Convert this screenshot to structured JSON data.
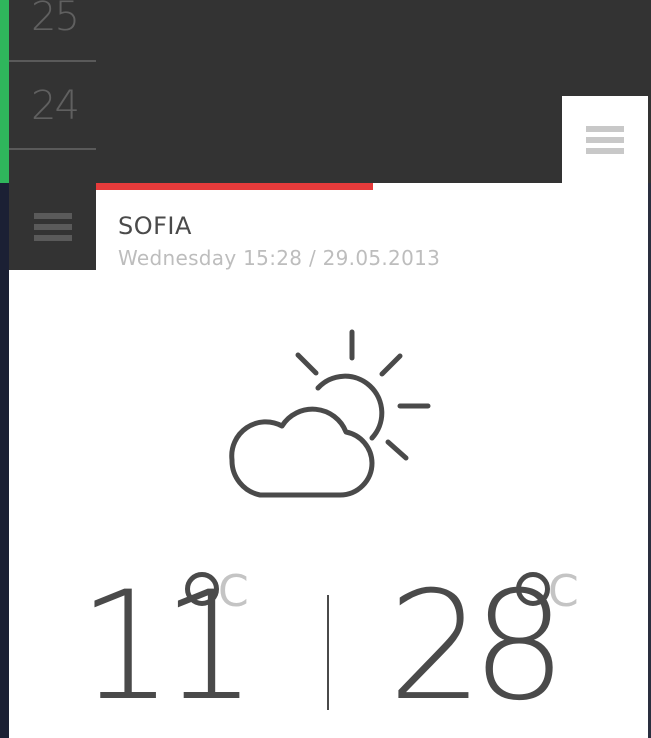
{
  "dates": [
    {
      "label": "25"
    },
    {
      "label": "24"
    }
  ],
  "location": {
    "city": "SOFIA",
    "datetime": "Wednesday 15:28 / 29.05.2013"
  },
  "weather": {
    "condition_icon": "partly-cloudy-icon",
    "temp_min": "11",
    "temp_max": "28",
    "unit": "C"
  },
  "colors": {
    "accent_green": "#2fb65c",
    "accent_red": "#e73b3b",
    "dark_bg": "#333333",
    "menu_light": "#c8c8c8",
    "menu_dark": "#5a5a5a"
  },
  "icons": {
    "menu_top": "menu-icon",
    "menu_left": "menu-icon"
  }
}
